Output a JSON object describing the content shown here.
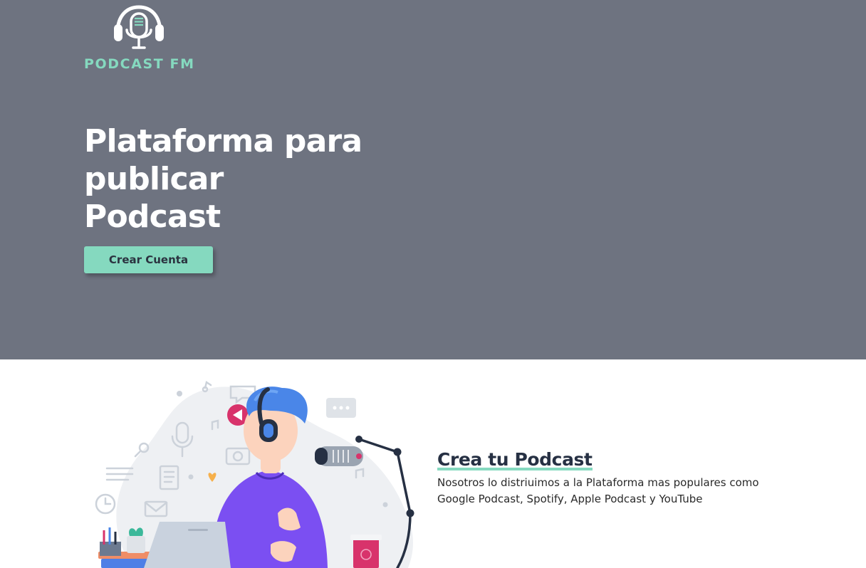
{
  "hero": {
    "logo_text": "PODCAST FM",
    "headline_lines": [
      "Plataforma para",
      "publicar",
      "Podcast"
    ],
    "cta_label": "Crear Cuenta"
  },
  "feature": {
    "title": "Crea tu Podcast",
    "description": "Nosotros lo distriuimos a la Plataforma mas populares como Google Podcast, Spotify, Apple Podcast y YouTube"
  },
  "icons": {
    "logo": "podcast-headphones-microphone-icon",
    "illustration": "podcaster-with-headphones-and-microphone-illustration"
  },
  "colors": {
    "hero_bg": "#6e7380",
    "accent": "#85d9bf",
    "heading_dark": "#263043",
    "shirt_purple": "#7b4ff2",
    "hair_blue": "#4a86e8",
    "play_pink": "#d8336b"
  }
}
